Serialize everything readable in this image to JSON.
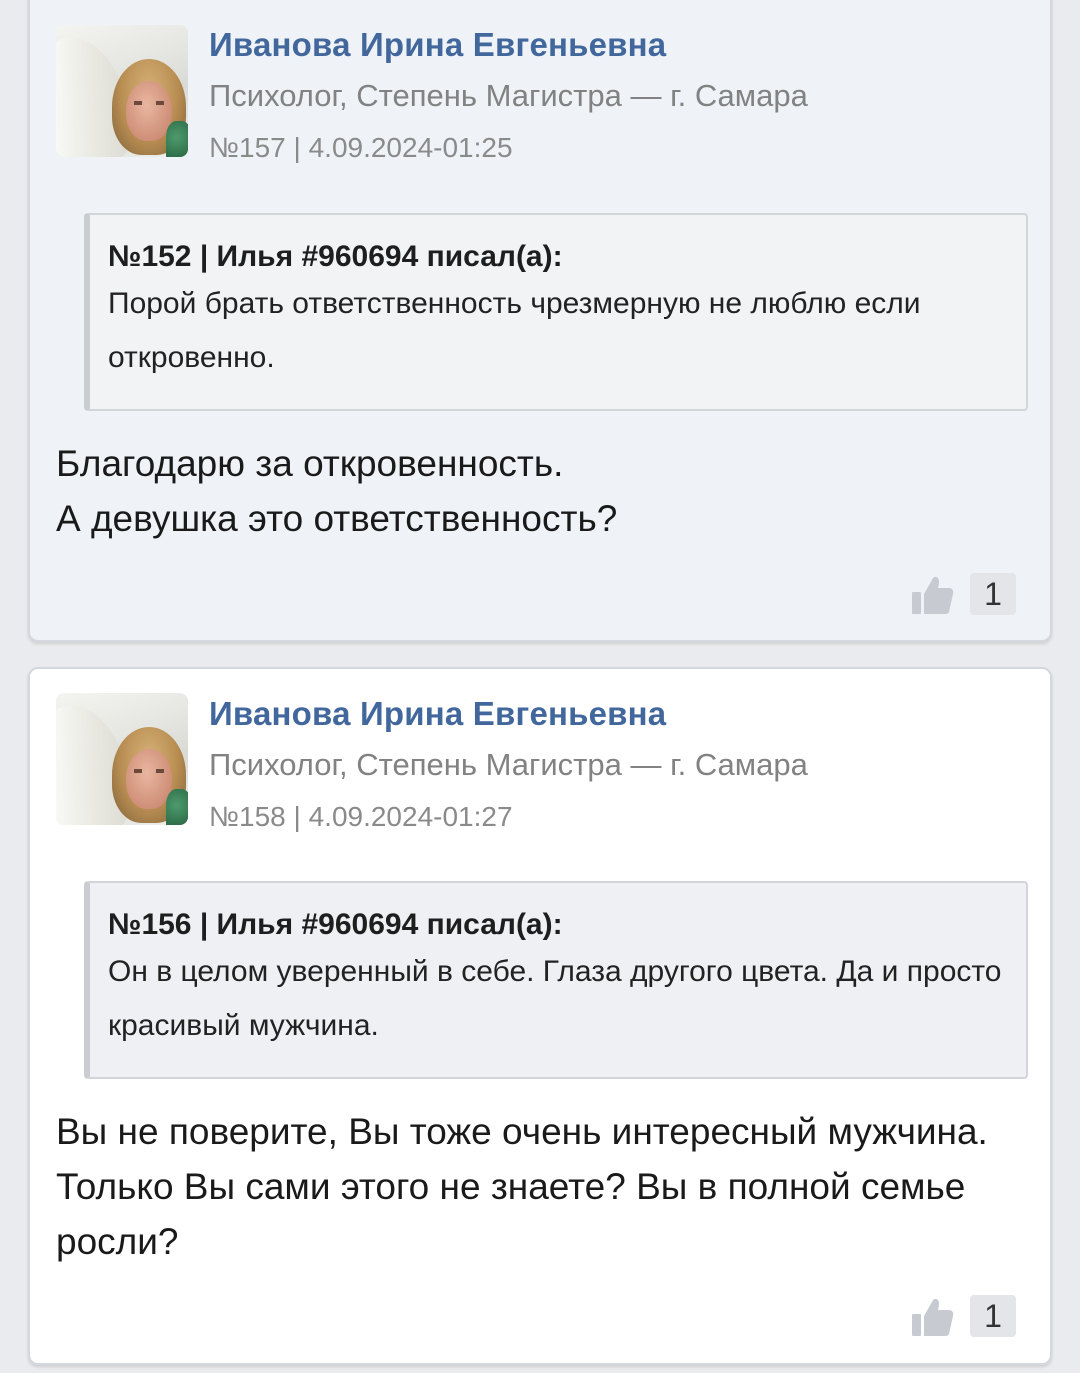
{
  "posts": [
    {
      "author": "Иванова Ирина Евгеньевна",
      "role": "Психолог, Степень Магистра — г. Самара",
      "meta": "№157 | 4.09.2024-01:25",
      "quote": {
        "header": "№152 | Илья #960694 писал(а):",
        "text": "Порой брать ответственность чрезмерную не люблю если откровенно."
      },
      "text_lines": [
        "Благодарю за откровенность.",
        "А девушка это ответственность?"
      ],
      "likes": "1"
    },
    {
      "author": "Иванова Ирина Евгеньевна",
      "role": "Психолог, Степень Магистра — г. Самара",
      "meta": "№158 | 4.09.2024-01:27",
      "quote": {
        "header": "№156 | Илья #960694 писал(а):",
        "text": "Он в целом уверенный в себе. Глаза другого цвета. Да и просто красивый мужчина."
      },
      "text": "Вы не поверите, Вы тоже очень интересный мужчина. Только Вы сами этого не знаете? Вы в полной семье росли?",
      "likes": "1"
    }
  ],
  "icons": {
    "avatar": "avatar-photo",
    "like": "thumbs-up-icon"
  },
  "colors": {
    "author": "#41679c",
    "muted": "#828282",
    "quote_bg": "#eef0f3"
  }
}
